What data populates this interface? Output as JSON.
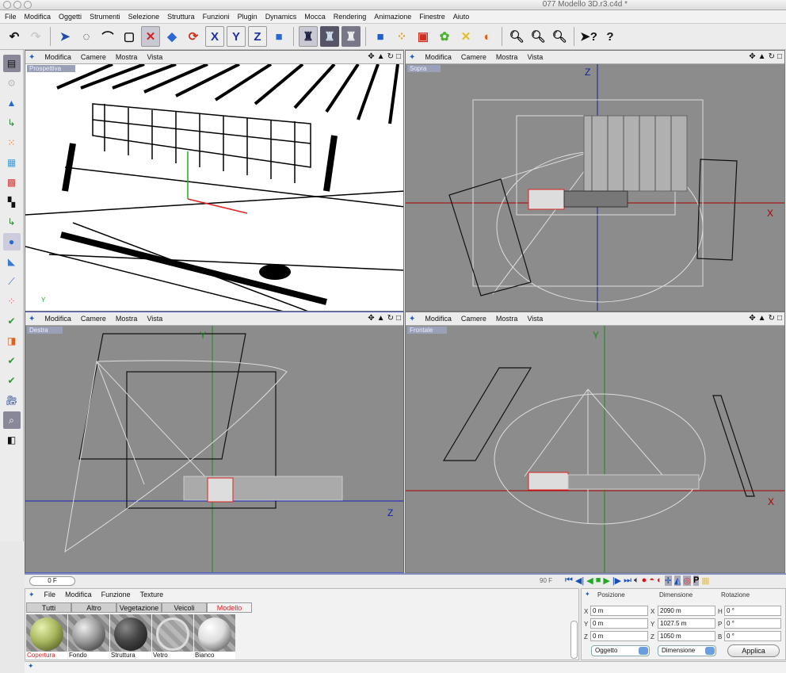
{
  "window": {
    "title": "077 Modello 3D.r3.c4d *"
  },
  "menu": [
    "File",
    "Modifica",
    "Oggetti",
    "Strumenti",
    "Selezione",
    "Struttura",
    "Funzioni",
    "Plugin",
    "Dynamics",
    "Mocca",
    "Rendering",
    "Animazione",
    "Finestre",
    "Aiuto"
  ],
  "toolbar": {
    "undo": "undo-icon",
    "redo": "redo-icon",
    "x_axis": "X",
    "y_axis": "Y",
    "z_axis": "Z"
  },
  "viewports": [
    {
      "label": "Prospettiva",
      "menu": [
        "Modifica",
        "Camere",
        "Mostra",
        "Vista"
      ],
      "bg": "#ffffff"
    },
    {
      "label": "Sopra",
      "menu": [
        "Modifica",
        "Camere",
        "Mostra",
        "Vista"
      ],
      "bg": "#8c8c8c",
      "axes": [
        "Z",
        "X"
      ]
    },
    {
      "label": "Destra",
      "menu": [
        "Modifica",
        "Camere",
        "Mostra",
        "Vista"
      ],
      "bg": "#8c8c8c",
      "axes": [
        "Y",
        "Z"
      ]
    },
    {
      "label": "Frontale",
      "menu": [
        "Modifica",
        "Camere",
        "Mostra",
        "Vista"
      ],
      "bg": "#8c8c8c",
      "axes": [
        "Y",
        "X"
      ]
    }
  ],
  "timeline": {
    "current_frame": "0 F",
    "end_frame": "90 F"
  },
  "materials": {
    "menu": [
      "File",
      "Modifica",
      "Funzione",
      "Texture"
    ],
    "tabs": [
      "Tutti",
      "Altro",
      "Vegetazione",
      "Veicoli",
      "Modello"
    ],
    "active_tab": "Modello",
    "items": [
      {
        "name": "Copertura",
        "color": "#a8b860"
      },
      {
        "name": "Fondo",
        "color": "#9a9a9a"
      },
      {
        "name": "Struttura",
        "color": "#555555"
      },
      {
        "name": "Vetro",
        "color": "#c8c8c8"
      },
      {
        "name": "Bianco",
        "color": "#e8e8e8"
      }
    ]
  },
  "coordinates": {
    "headers": [
      "Posizione",
      "Dimensione",
      "Rotazione"
    ],
    "position": [
      {
        "axis": "X",
        "value": "0 m"
      },
      {
        "axis": "Y",
        "value": "0 m"
      },
      {
        "axis": "Z",
        "value": "0 m"
      }
    ],
    "size": [
      {
        "axis": "X",
        "value": "2090 m"
      },
      {
        "axis": "Y",
        "value": "1027.5 m"
      },
      {
        "axis": "Z",
        "value": "1050 m"
      }
    ],
    "rotation": [
      {
        "axis": "H",
        "value": "0 °"
      },
      {
        "axis": "P",
        "value": "0 °"
      },
      {
        "axis": "B",
        "value": "0 °"
      }
    ],
    "mode_select": "Oggetto",
    "size_select": "Dimensione",
    "apply": "Applica"
  }
}
